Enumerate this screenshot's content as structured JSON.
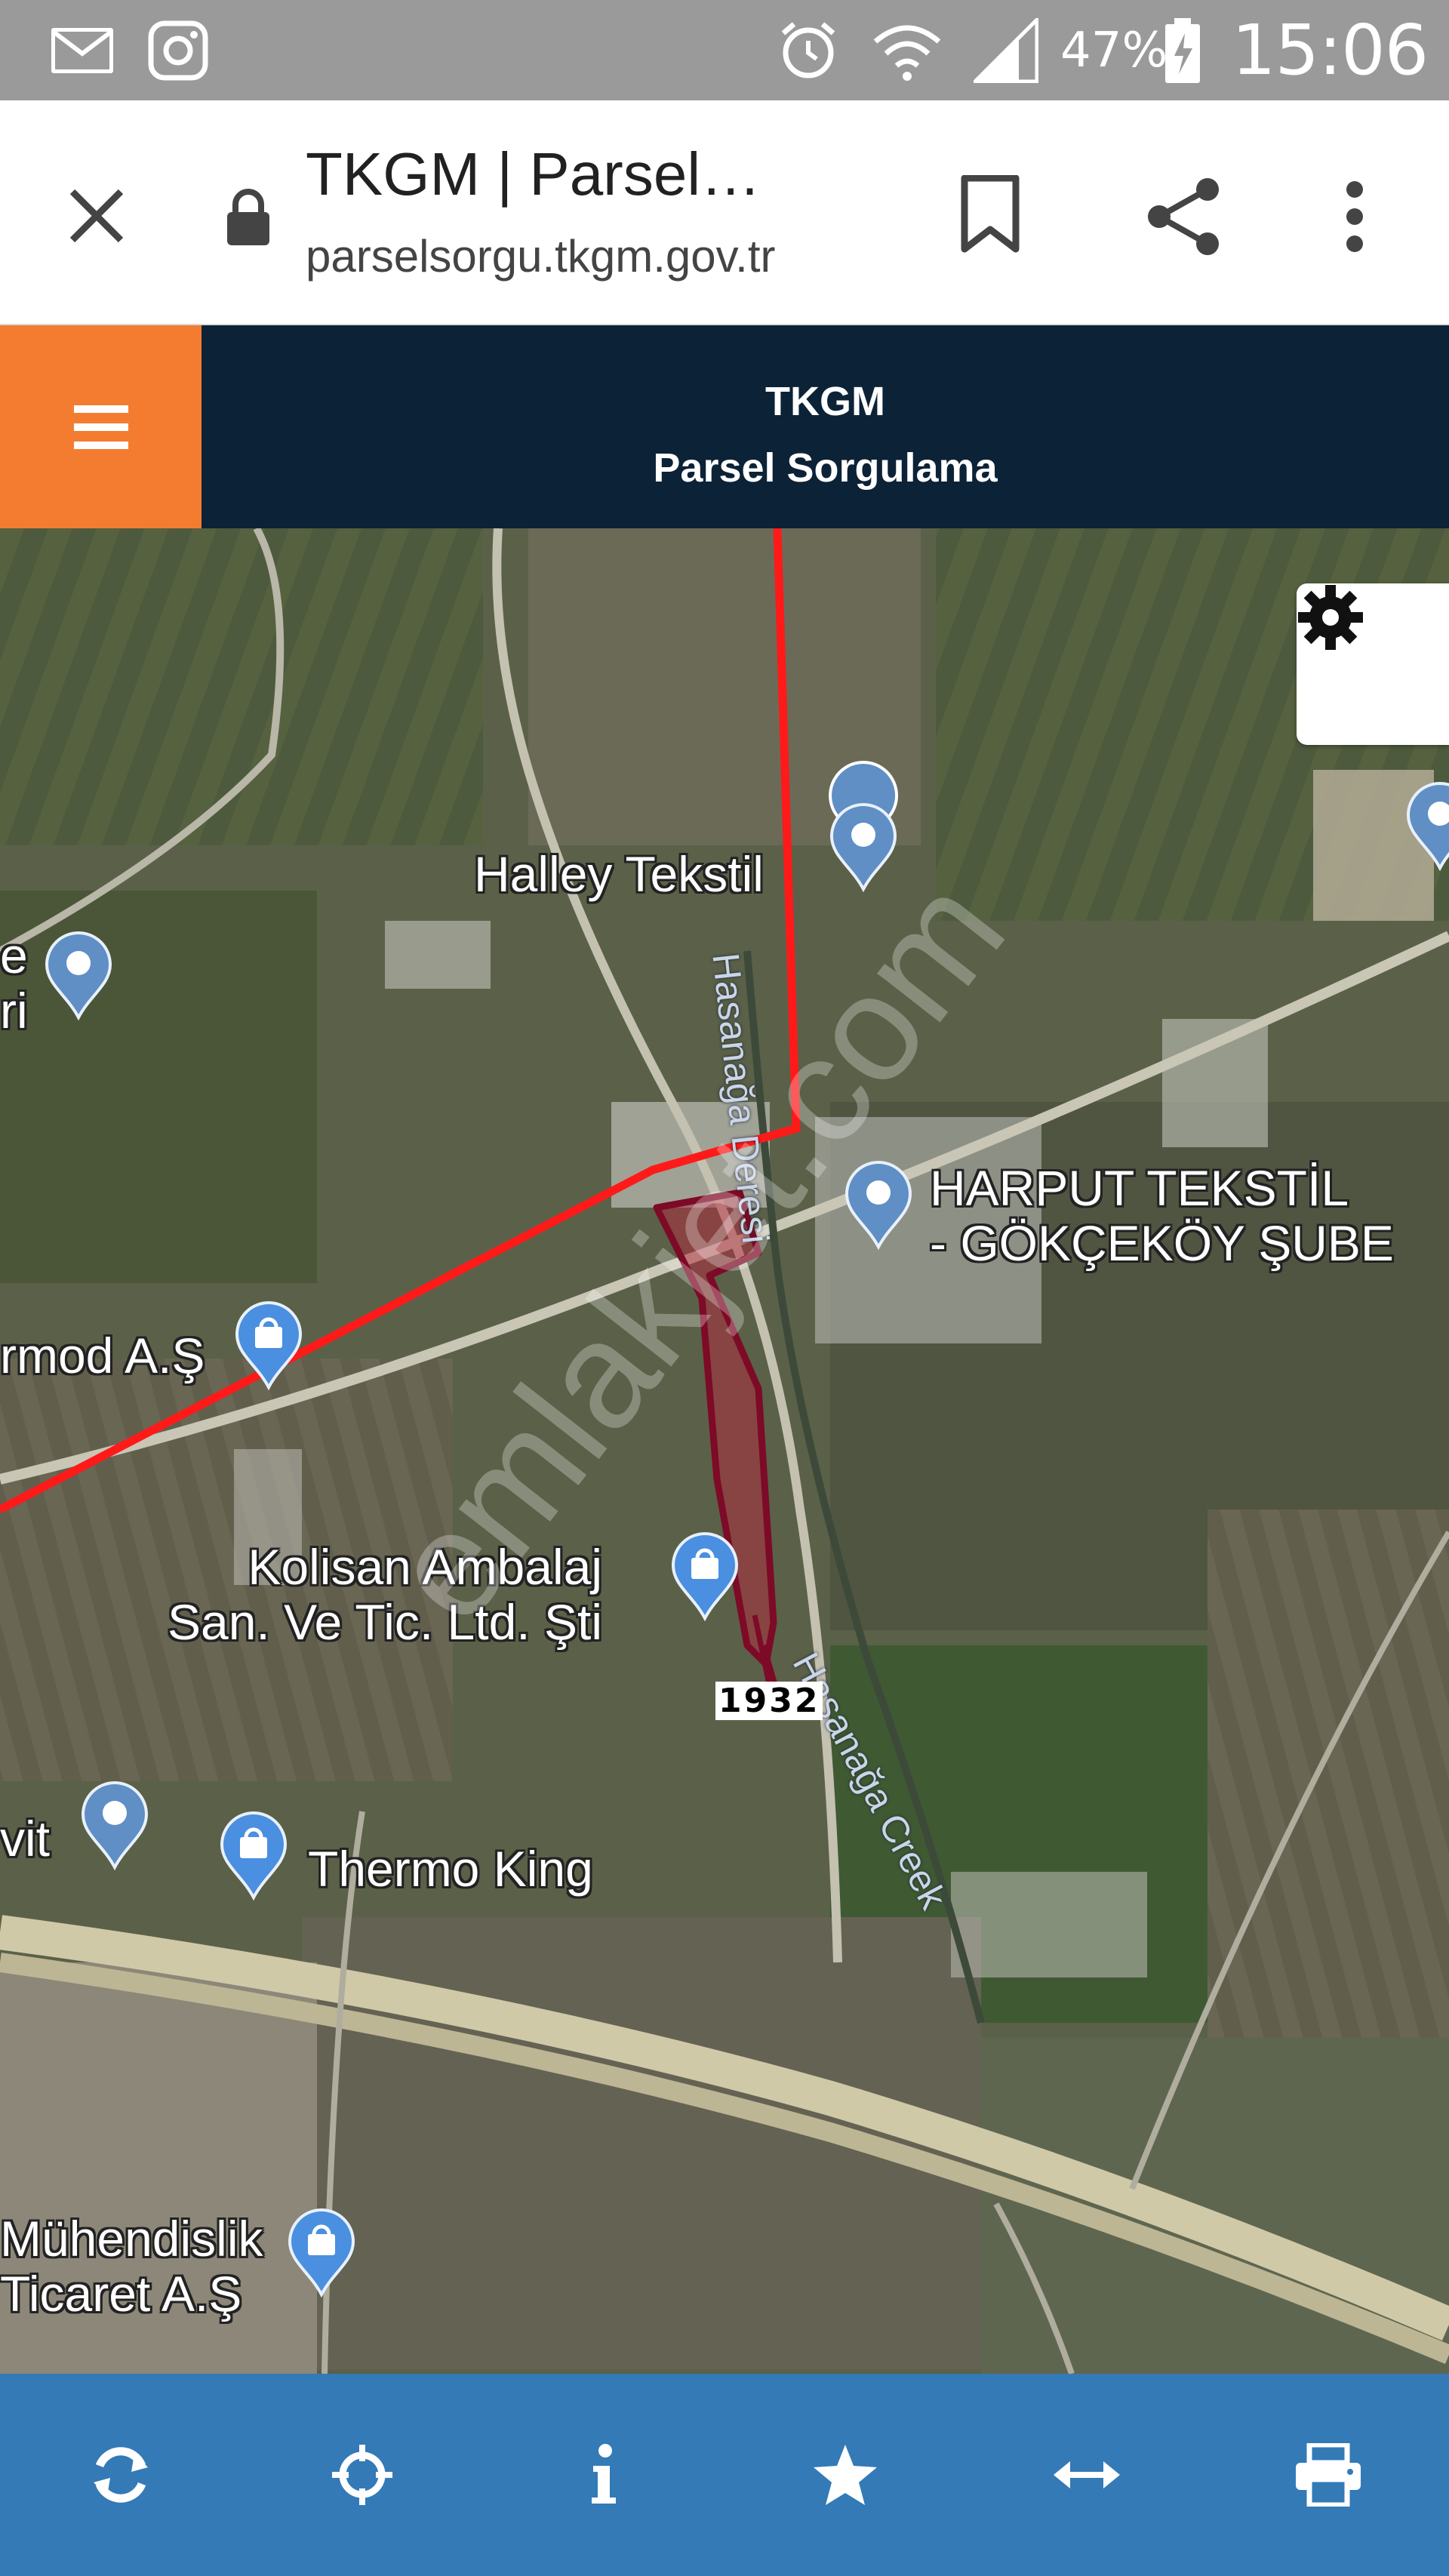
{
  "status_bar": {
    "battery_percent": "47%",
    "clock": "15:06",
    "icons": [
      "mail-icon",
      "instagram-icon",
      "alarm-icon",
      "wifi-icon",
      "signal-icon",
      "battery-charging-icon"
    ]
  },
  "browser": {
    "page_title": "TKGM | Parsel…",
    "url": "parselsorgu.tkgm.gov.tr",
    "icons": [
      "close-icon",
      "lock-icon",
      "bookmark-icon",
      "share-icon",
      "overflow-menu-icon"
    ]
  },
  "app_header": {
    "title": "TKGM",
    "subtitle": "Parsel Sorgulama",
    "menu_icon": "hamburger-icon",
    "accent_color": "#f47c31",
    "background_color": "#0c2237"
  },
  "map": {
    "settings_icon": "gear-icon",
    "places": [
      {
        "name": "Halley Tekstil",
        "pin": "place-pin"
      },
      {
        "name": "HARPUT TEKSTİL\n- GÖKÇEKÖY ŞUBE",
        "pin": "place-pin"
      },
      {
        "name": "rmod A.Ş",
        "pin": "shopping-pin"
      },
      {
        "name": "Kolisan Ambalaj\nSan. Ve Tic. Ltd. Şti",
        "pin": "shopping-pin"
      },
      {
        "name": "Thermo King",
        "pin": "shopping-pin"
      },
      {
        "name": "Mühendislik\nTicaret A.Ş",
        "pin": "shopping-pin"
      },
      {
        "name": "vit",
        "pin": "place-pin"
      },
      {
        "name": "e\nri",
        "pin": "place-pin"
      }
    ],
    "creek_labels": [
      "Hasanağa Deresi",
      "Hasanağa Creek"
    ],
    "parcel_number": "1932",
    "watermark": "emlakjet.com",
    "parcel_color": "#8b0a2a",
    "line_color": "#ff1a1a"
  },
  "toolbar": {
    "background_color": "#337ab7",
    "buttons": [
      "refresh-icon",
      "locate-icon",
      "info-icon",
      "star-icon",
      "measure-icon",
      "print-icon"
    ]
  }
}
